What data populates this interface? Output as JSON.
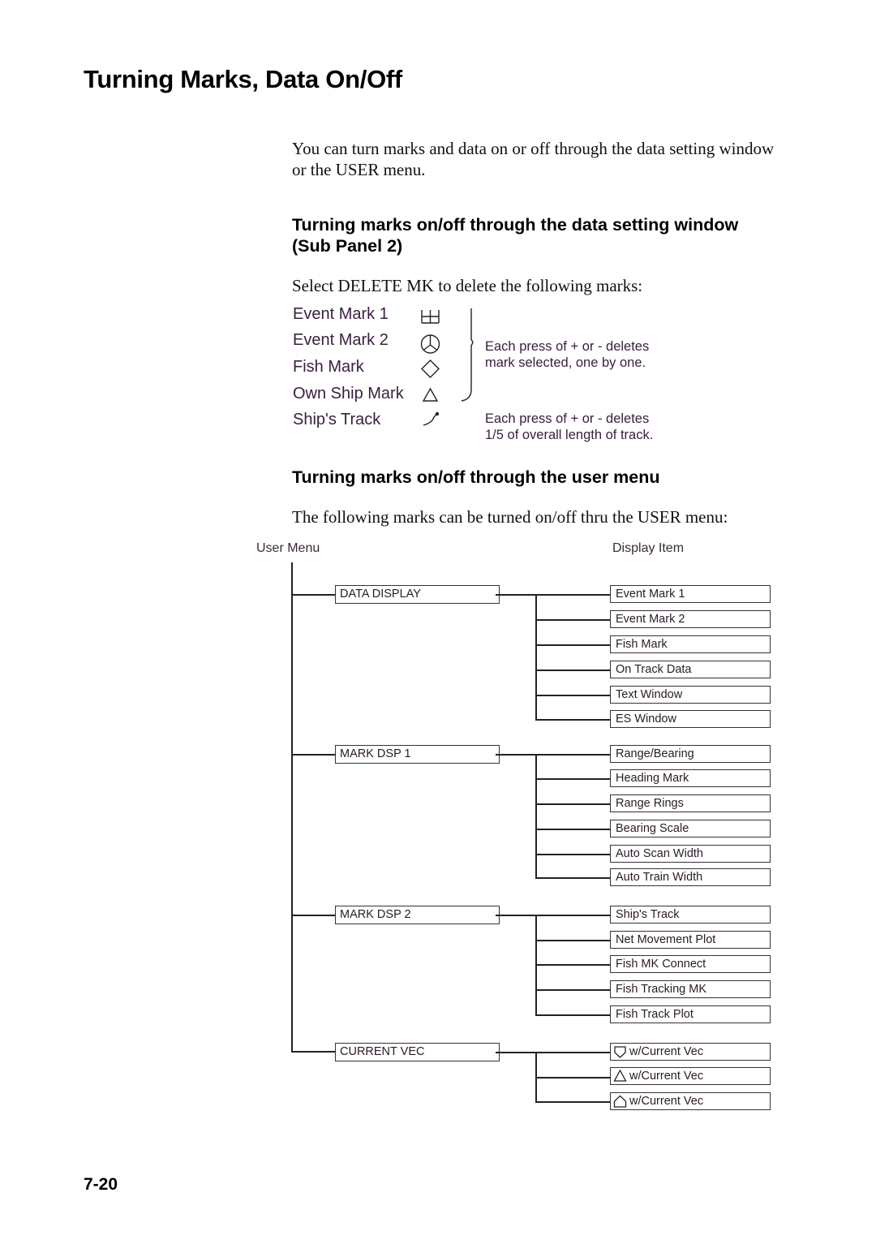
{
  "page": {
    "title": "Turning Marks, Data On/Off",
    "intro": "You can turn marks and data on or off through the data setting window or the USER menu.",
    "page_number": "7-20"
  },
  "section1": {
    "heading": "Turning marks on/off through the data setting window (Sub Panel 2)",
    "instruction": "Select DELETE MK to delete the following marks:",
    "marks": [
      {
        "label": "Event Mark 1",
        "icon": "event-mark-1-icon"
      },
      {
        "label": "Event Mark 2",
        "icon": "event-mark-2-icon"
      },
      {
        "label": "Fish Mark",
        "icon": "diamond-icon"
      },
      {
        "label": "Own Ship Mark",
        "icon": "triangle-icon"
      },
      {
        "label": "Ship's Track",
        "icon": "track-icon"
      }
    ],
    "note_group": [
      "Each press of + or - deletes",
      "mark selected, one by one."
    ],
    "note_track": [
      "Each press of + or - deletes",
      "1/5 of overall length of track."
    ]
  },
  "section2": {
    "heading": "Turning marks on/off through the user menu",
    "instruction": "The following marks can be turned on/off thru the USER menu:",
    "col_user_menu": "User Menu",
    "col_display_item": "Display Item",
    "groups": [
      {
        "menu": "DATA DISPLAY",
        "items": [
          "Event Mark 1",
          "Event Mark 2",
          "Fish Mark",
          "On Track Data",
          "Text Window",
          "ES Window"
        ]
      },
      {
        "menu": "MARK DSP 1",
        "items": [
          "Range/Bearing",
          "Heading Mark",
          "Range Rings",
          "Bearing Scale",
          "Auto Scan Width",
          "Auto Train Width"
        ]
      },
      {
        "menu": "MARK DSP 2",
        "items": [
          "Ship's Track",
          "Net Movement Plot",
          "Fish MK Connect",
          "Fish Tracking MK",
          "Fish Track Plot"
        ]
      },
      {
        "menu": "CURRENT VEC",
        "items": [
          {
            "icon": "shield-down-icon",
            "label": "w/Current Vec"
          },
          {
            "icon": "triangle-icon",
            "label": "w/Current Vec"
          },
          {
            "icon": "house-icon",
            "label": "w/Current Vec"
          }
        ]
      }
    ]
  }
}
